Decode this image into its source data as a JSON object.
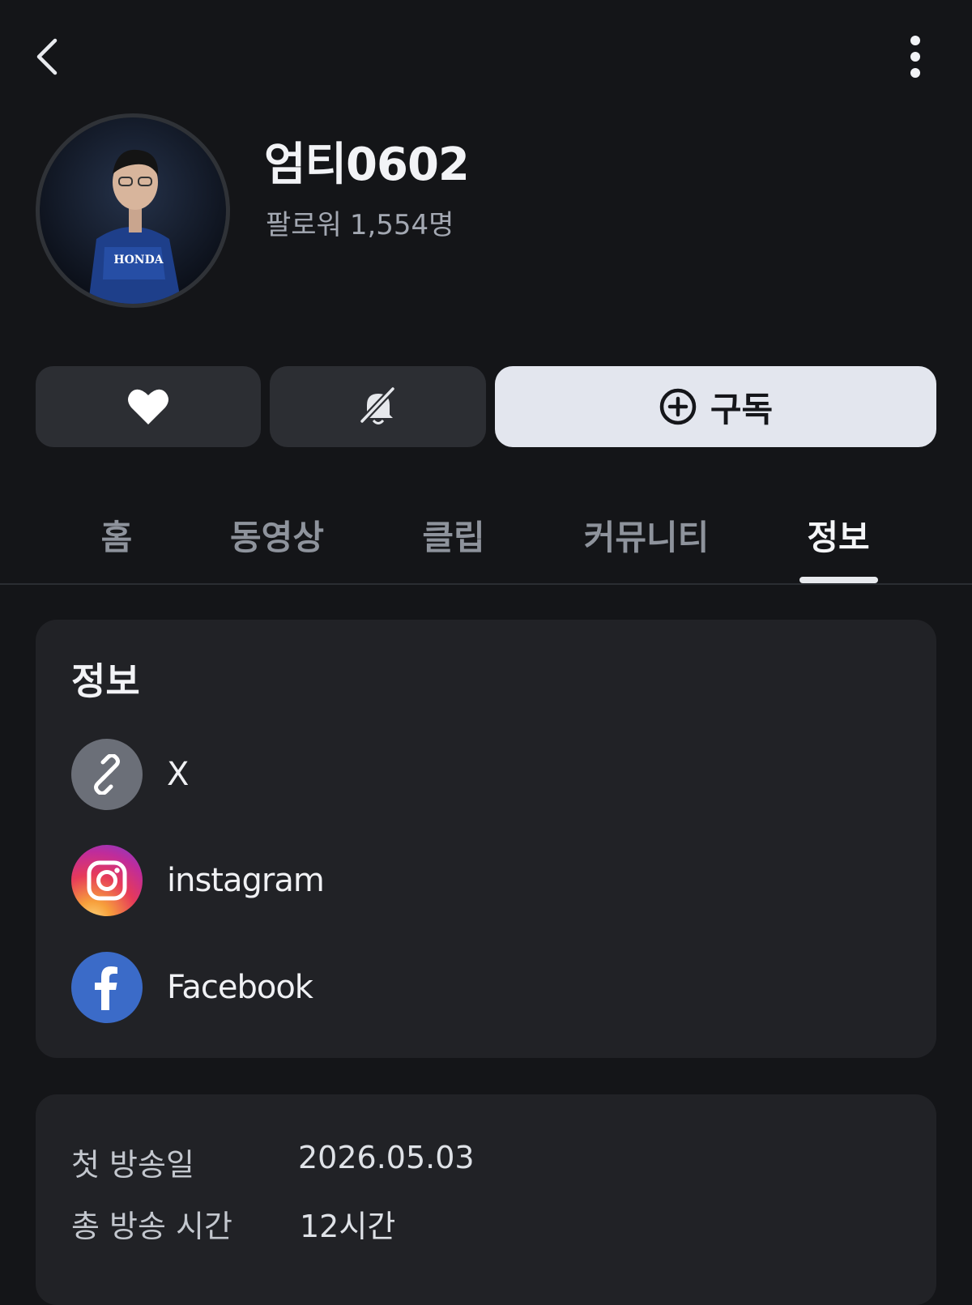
{
  "profile": {
    "name": "엄티0602",
    "followers_label": "팔로워",
    "followers_count": "1,554명"
  },
  "actions": {
    "subscribe_label": "구독"
  },
  "tabs": [
    {
      "label": "홈"
    },
    {
      "label": "동영상"
    },
    {
      "label": "클립"
    },
    {
      "label": "커뮤니티"
    },
    {
      "label": "정보",
      "active": true
    }
  ],
  "info": {
    "title": "정보",
    "links": [
      {
        "label": "X",
        "icon": "link-icon"
      },
      {
        "label": "instagram",
        "icon": "instagram-icon"
      },
      {
        "label": "Facebook",
        "icon": "facebook-icon"
      }
    ]
  },
  "stats": {
    "first_broadcast_label": "첫 방송일",
    "first_broadcast_value": "2026.05.03",
    "total_time_label": "총 방송 시간",
    "total_time_value": "12시간"
  },
  "colors": {
    "background": "#141518",
    "card": "#212226",
    "subscribe_bg": "#e3e6ee",
    "facebook": "#3b6bc8"
  }
}
